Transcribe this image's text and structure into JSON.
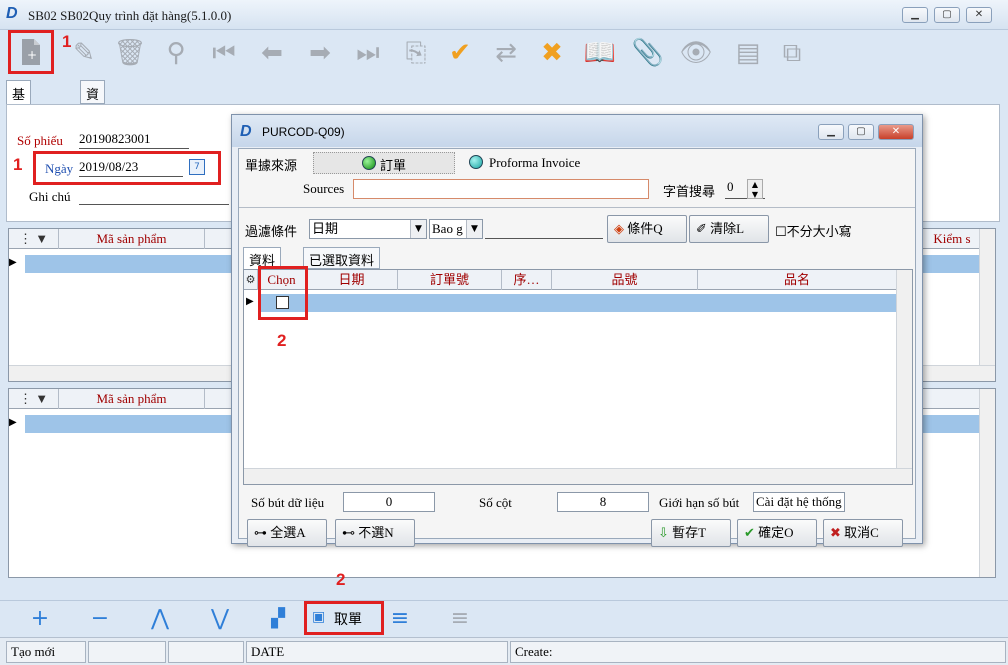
{
  "window": {
    "title": "SB02 SB02Quy trình đặt hàng(5.1.0.0)",
    "min": "▁",
    "max": "▢",
    "close": "✕"
  },
  "annotations": {
    "one": "1",
    "two": "2"
  },
  "toolbar": {
    "icons": [
      "new-doc-icon",
      "edit-pencil-icon",
      "delete-trash-icon",
      "search-magnifier-icon",
      "first-record-icon",
      "prev-record-icon",
      "next-record-icon",
      "last-record-icon",
      "copy-doc-icon",
      "confirm-check-icon",
      "refresh-icon",
      "cancel-x-icon",
      "book-icon",
      "attach-clip-icon",
      "view-eye-icon",
      "export-xls-icon",
      "flow-icon"
    ]
  },
  "tabs": [
    "基本資料",
    "資料瀏覽"
  ],
  "form": {
    "so_phieu_label": "Số phiếu",
    "so_phieu_value": "20190823001",
    "ngay_label": "Ngày",
    "ngay_value": "2019/08/23",
    "ghi_chu_label": "Ghi chú"
  },
  "grid1": {
    "col_ma": "Mã sản phẩm",
    "col_kiem": "Kiểm s"
  },
  "grid2": {
    "col_ma": "Mã sản phẩm"
  },
  "dialog": {
    "title": "PURCOD-Q09)",
    "source_label": "單據來源",
    "option1": "訂單",
    "option2": "Proforma Invoice",
    "sources_label": "Sources",
    "sources_value": "",
    "prefix_label": "字首搜尋",
    "prefix_value": "0",
    "filter_label": "過濾條件",
    "filter_field": "日期",
    "filter_op": "Bao g",
    "filter_value": "",
    "cond_button": "條件Q",
    "clear_button": "清除L",
    "case_label": "不分大小寫",
    "tab1": "資料",
    "tab2": "已選取資料",
    "columns": [
      "Chọn",
      "日期",
      "訂單號",
      "序…",
      "品號",
      "品名"
    ],
    "count_label": "Số bút dữ liệu",
    "count_value": "0",
    "cols_label": "Số cột",
    "cols_value": "8",
    "limit_label": "Giới hạn số bút",
    "limit_value": "Cài đặt hệ thống",
    "select_all": "全選A",
    "select_none": "不選N",
    "save_temp": "暫存T",
    "ok": "確定O",
    "cancel": "取消C"
  },
  "bottom": {
    "take_order": "取單"
  },
  "status": {
    "mode": "Tạo mới",
    "field": "DATE",
    "create": "Create:"
  },
  "colors": {
    "accent_red": "#e02020",
    "label_red": "#b00000",
    "select_blue": "#9ec4e8"
  }
}
